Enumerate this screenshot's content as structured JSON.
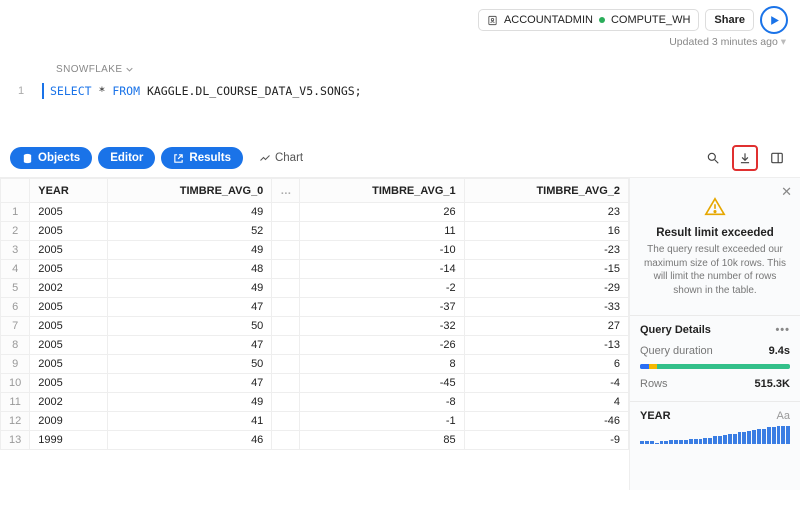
{
  "top": {
    "role": "ACCOUNTADMIN",
    "warehouse": "COMPUTE_WH",
    "share": "Share",
    "updated": "Updated 3 minutes ago"
  },
  "breadcrumb": "SNOWFLAKE",
  "query": {
    "line_no": "1",
    "kw_select": "SELECT",
    "star": " * ",
    "kw_from": "FROM",
    "rest": " KAGGLE.DL_COURSE_DATA_V5.SONGS;"
  },
  "tabs": {
    "objects": "Objects",
    "editor": "Editor",
    "results": "Results",
    "chart": "Chart"
  },
  "table": {
    "columns": [
      "YEAR",
      "TIMBRE_AVG_0",
      "TIMBRE_AVG_1",
      "TIMBRE_AVG_2"
    ],
    "rows": [
      {
        "idx": "1",
        "c": [
          "2005",
          "49",
          "26",
          "23"
        ]
      },
      {
        "idx": "2",
        "c": [
          "2005",
          "52",
          "11",
          "16"
        ]
      },
      {
        "idx": "3",
        "c": [
          "2005",
          "49",
          "-10",
          "-23"
        ]
      },
      {
        "idx": "4",
        "c": [
          "2005",
          "48",
          "-14",
          "-15"
        ]
      },
      {
        "idx": "5",
        "c": [
          "2002",
          "49",
          "-2",
          "-29"
        ]
      },
      {
        "idx": "6",
        "c": [
          "2005",
          "47",
          "-37",
          "-33"
        ]
      },
      {
        "idx": "7",
        "c": [
          "2005",
          "50",
          "-32",
          "27"
        ]
      },
      {
        "idx": "8",
        "c": [
          "2005",
          "47",
          "-26",
          "-13"
        ]
      },
      {
        "idx": "9",
        "c": [
          "2005",
          "50",
          "8",
          "6"
        ]
      },
      {
        "idx": "10",
        "c": [
          "2005",
          "47",
          "-45",
          "-4"
        ]
      },
      {
        "idx": "11",
        "c": [
          "2002",
          "49",
          "-8",
          "4"
        ]
      },
      {
        "idx": "12",
        "c": [
          "2009",
          "41",
          "-1",
          "-46"
        ]
      },
      {
        "idx": "13",
        "c": [
          "1999",
          "46",
          "85",
          "-9"
        ]
      }
    ]
  },
  "alert": {
    "title": "Result limit exceeded",
    "body": "The query result exceeded our maximum size of 10k rows. This will limit the number of rows shown in the table."
  },
  "details": {
    "heading": "Query Details",
    "duration_label": "Query duration",
    "duration_value": "9.4s",
    "rows_label": "Rows",
    "rows_value": "515.3K"
  },
  "year": {
    "label": "YEAR",
    "aa": "Aa"
  },
  "chart_data": {
    "type": "bar",
    "categories": [
      "",
      "",
      "",
      "",
      "",
      "",
      "",
      "",
      "",
      "",
      "",
      "",
      "",
      "",
      "",
      "",
      "",
      "",
      "",
      "",
      "",
      "",
      "",
      "",
      "",
      "",
      "",
      "",
      "",
      "",
      ""
    ],
    "values": [
      2,
      2,
      2,
      1,
      2,
      2,
      3,
      3,
      3,
      3,
      4,
      4,
      4,
      5,
      5,
      6,
      6,
      7,
      8,
      8,
      9,
      9,
      10,
      11,
      12,
      12,
      13,
      13,
      14,
      14,
      14
    ],
    "title": "YEAR",
    "xlabel": "",
    "ylabel": "",
    "ylim": [
      0,
      15
    ]
  }
}
